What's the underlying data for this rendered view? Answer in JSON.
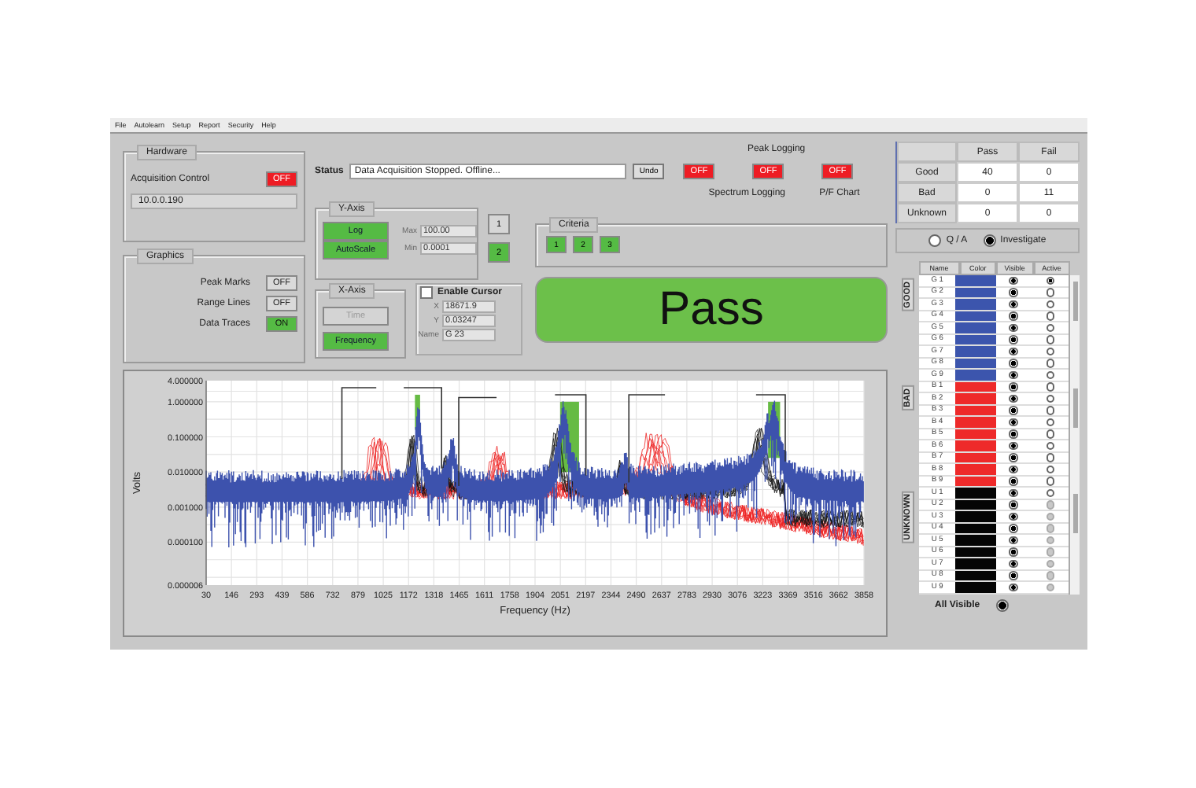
{
  "menu": [
    "File",
    "Autolearn",
    "Setup",
    "Report",
    "Security",
    "Help"
  ],
  "hardware": {
    "title": "Hardware",
    "label": "Acquisition Control",
    "toggle": {
      "label": "OFF",
      "on": false
    },
    "address": "10.0.0.190"
  },
  "graphics": {
    "title": "Graphics",
    "rows": [
      {
        "label": "Peak Marks",
        "toggle": "OFF",
        "on": false
      },
      {
        "label": "Range Lines",
        "toggle": "OFF",
        "on": false
      },
      {
        "label": "Data Traces",
        "toggle": "ON",
        "on": true
      }
    ]
  },
  "status": {
    "label": "Status",
    "value": "Data Acquisition Stopped. Offline...",
    "undo": "Undo"
  },
  "logging": {
    "labels": [
      {
        "text": "Peak Logging",
        "kind": "above"
      },
      {
        "text": "Spectrum Logging",
        "kind": "below"
      },
      {
        "text": "P/F Chart",
        "kind": "below"
      }
    ],
    "toggles": [
      {
        "label": "OFF",
        "on": false
      },
      {
        "label": "OFF",
        "on": false
      },
      {
        "label": "OFF",
        "on": false
      }
    ]
  },
  "y_axis": {
    "title": "Y-Axis",
    "buttons": [
      {
        "label": "Log",
        "selected": true
      },
      {
        "label": "AutoScale",
        "selected": true
      }
    ],
    "fields": [
      {
        "label": "Max",
        "value": "100.00"
      },
      {
        "label": "Min",
        "value": "0.0001"
      }
    ]
  },
  "plot_buttons": [
    {
      "label": "1",
      "selected": false
    },
    {
      "label": "2",
      "selected": true
    }
  ],
  "x_axis": {
    "title": "X-Axis",
    "buttons": [
      {
        "label": "Time",
        "selected": false
      },
      {
        "label": "Frequency",
        "selected": true
      }
    ]
  },
  "cursor": {
    "label": "Enable Cursor",
    "checked": false,
    "fields": [
      {
        "label": "X",
        "value": "18671.9"
      },
      {
        "label": "Y",
        "value": "0.03247"
      },
      {
        "label": "Name",
        "value": "G 23"
      }
    ]
  },
  "criteria": {
    "title": "Criteria",
    "buttons": [
      "1",
      "2",
      "3"
    ]
  },
  "result": {
    "label": "Pass",
    "pass": true
  },
  "chart": {
    "ylabel": "Volts",
    "xlabel": "Frequency (Hz)",
    "yticks": [
      "4.000000",
      "1.000000",
      "0.100000",
      "0.010000",
      "0.001000",
      "0.000100",
      "0.000006"
    ],
    "xticks": [
      "30",
      "146",
      "293",
      "439",
      "586",
      "732",
      "879",
      "1025",
      "1172",
      "1318",
      "1465",
      "1611",
      "1758",
      "1904",
      "2051",
      "2197",
      "2344",
      "2490",
      "2637",
      "2783",
      "2930",
      "3076",
      "3223",
      "3369",
      "3516",
      "3662",
      "3858"
    ]
  },
  "summary": {
    "columns": [
      "Pass",
      "Fail"
    ],
    "rows": [
      {
        "label": "Good",
        "values": [
          "40",
          "0"
        ]
      },
      {
        "label": "Bad",
        "values": [
          "0",
          "11"
        ]
      },
      {
        "label": "Unknown",
        "values": [
          "0",
          "0"
        ]
      }
    ]
  },
  "mode": [
    {
      "label": "Q / A",
      "selected": false
    },
    {
      "label": "Investigate",
      "selected": true
    }
  ],
  "traces": {
    "columns": [
      "Name",
      "Color",
      "Visible",
      "Active"
    ],
    "groups": [
      {
        "label": "GOOD",
        "color": "#3c55ad",
        "items": [
          {
            "name": "G 1",
            "visible": true,
            "active": true,
            "disabled": false
          },
          {
            "name": "G 2",
            "visible": true,
            "active": false,
            "disabled": false
          },
          {
            "name": "G 3",
            "visible": true,
            "active": false,
            "disabled": false
          },
          {
            "name": "G 4",
            "visible": true,
            "active": false,
            "disabled": false
          },
          {
            "name": "G 5",
            "visible": true,
            "active": false,
            "disabled": false
          },
          {
            "name": "G 6",
            "visible": true,
            "active": false,
            "disabled": false
          },
          {
            "name": "G 7",
            "visible": true,
            "active": false,
            "disabled": false
          },
          {
            "name": "G 8",
            "visible": true,
            "active": false,
            "disabled": false
          },
          {
            "name": "G 9",
            "visible": true,
            "active": false,
            "disabled": false
          }
        ]
      },
      {
        "label": "BAD",
        "color": "#ee2a2a",
        "items": [
          {
            "name": "B 1",
            "visible": true,
            "active": false,
            "disabled": false
          },
          {
            "name": "B 2",
            "visible": true,
            "active": false,
            "disabled": false
          },
          {
            "name": "B 3",
            "visible": true,
            "active": false,
            "disabled": false
          },
          {
            "name": "B 4",
            "visible": true,
            "active": false,
            "disabled": false
          },
          {
            "name": "B 5",
            "visible": true,
            "active": false,
            "disabled": false
          },
          {
            "name": "B 6",
            "visible": true,
            "active": false,
            "disabled": false
          },
          {
            "name": "B 7",
            "visible": true,
            "active": false,
            "disabled": false
          },
          {
            "name": "B 8",
            "visible": true,
            "active": false,
            "disabled": false
          },
          {
            "name": "B 9",
            "visible": true,
            "active": false,
            "disabled": false
          }
        ]
      },
      {
        "label": "UNKNOWN",
        "color": "#050505",
        "items": [
          {
            "name": "U 1",
            "visible": true,
            "active": false,
            "disabled": false
          },
          {
            "name": "U 2",
            "visible": true,
            "active": false,
            "disabled": true
          },
          {
            "name": "U 3",
            "visible": true,
            "active": false,
            "disabled": true
          },
          {
            "name": "U 4",
            "visible": true,
            "active": false,
            "disabled": true
          },
          {
            "name": "U 5",
            "visible": true,
            "active": false,
            "disabled": true
          },
          {
            "name": "U 6",
            "visible": true,
            "active": false,
            "disabled": true
          },
          {
            "name": "U 7",
            "visible": true,
            "active": false,
            "disabled": true
          },
          {
            "name": "U 8",
            "visible": true,
            "active": false,
            "disabled": true
          },
          {
            "name": "U 9",
            "visible": true,
            "active": false,
            "disabled": true
          }
        ]
      }
    ]
  },
  "all_visible": {
    "label": "All Visible",
    "checked": true
  }
}
